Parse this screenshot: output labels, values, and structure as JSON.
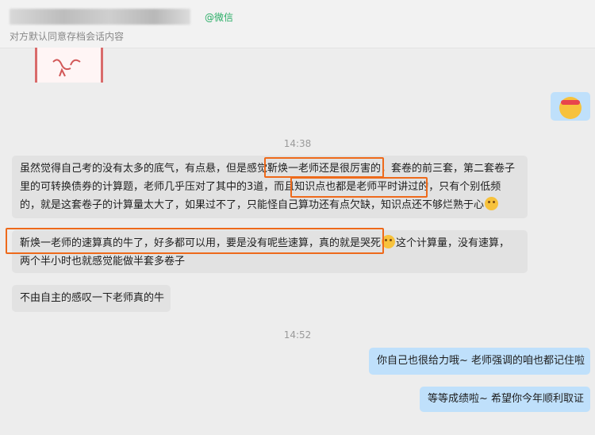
{
  "header": {
    "wx_tag": "@微信",
    "subtitle": "对方默认同意存档会话内容"
  },
  "colors": {
    "left_bubble": "#e2e2e2",
    "right_bubble": "#bfe0fb",
    "highlight": "#ee6a1b",
    "wx_green": "#2aae67"
  },
  "timestamps": [
    "14:38",
    "14:52"
  ],
  "messages": [
    {
      "side": "right",
      "type": "emoji",
      "icon": "headband-face-icon"
    },
    {
      "side": "left",
      "lines": [
        "虽然觉得自己考的没有太多的底气，有点悬，但是感觉靳焕一老师还是很厉害的，套卷的前三套，第二套卷子",
        "里的可转换债券的计算题，老师几乎压对了其中的3道，而且知识点也都是老师平时讲过的，只有个别低频",
        "的，就是这套卷子的计算量太大了，如果过不了，只能怪自己算功还有点欠缺，知识点还不够烂熟于心"
      ]
    },
    {
      "side": "left",
      "lines": [
        "靳焕一老师的速算真的牛了，好多都可以用，要是没有呢些速算，真的就是哭死",
        "这个计算量，没有速算，",
        "两个半小时也就感觉能做半套多卷子"
      ]
    },
    {
      "side": "left",
      "text": "不由自主的感叹一下老师真的牛"
    },
    {
      "side": "right",
      "text": "你自己也很给力哦~ 老师强调的咱也都记住啦"
    },
    {
      "side": "right",
      "text": "等等成绩啦~ 希望你今年顺利取证"
    }
  ]
}
